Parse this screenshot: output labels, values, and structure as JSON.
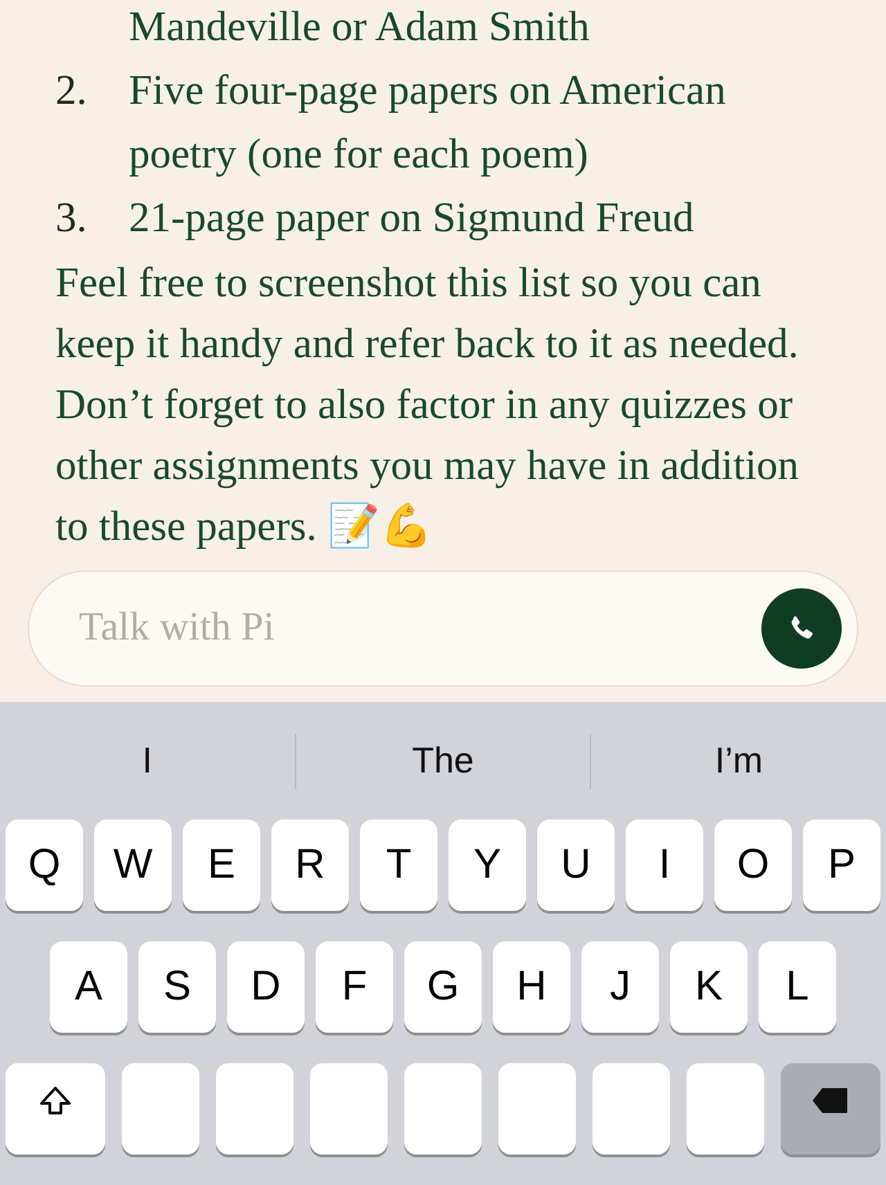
{
  "list": [
    {
      "text": "Mandeville or Adam Smith"
    },
    {
      "marker": "2.",
      "text": "Five four-page papers on American poetry (one for each poem)"
    },
    {
      "marker": "3.",
      "text": "21-page paper on Sigmund Freud"
    }
  ],
  "paragraph": "Feel free to screenshot this list so you can keep it handy and refer back to it as needed. Don’t forget to also factor in any quizzes or other assignments you may have in addition to these papers. 📝💪",
  "composer": {
    "placeholder": "Talk with Pi"
  },
  "keyboard": {
    "suggestions": [
      "I",
      "The",
      "I’m"
    ],
    "rows": [
      [
        "Q",
        "W",
        "E",
        "R",
        "T",
        "Y",
        "U",
        "I",
        "O",
        "P"
      ],
      [
        "A",
        "S",
        "D",
        "F",
        "G",
        "H",
        "J",
        "K",
        "L"
      ]
    ],
    "bottom_row": [
      {
        "kind": "shift"
      },
      {
        "kind": "blank"
      },
      {
        "kind": "blank"
      },
      {
        "kind": "blank"
      },
      {
        "kind": "blank"
      },
      {
        "kind": "blank"
      },
      {
        "kind": "blank"
      },
      {
        "kind": "blank"
      },
      {
        "kind": "delete"
      }
    ]
  }
}
